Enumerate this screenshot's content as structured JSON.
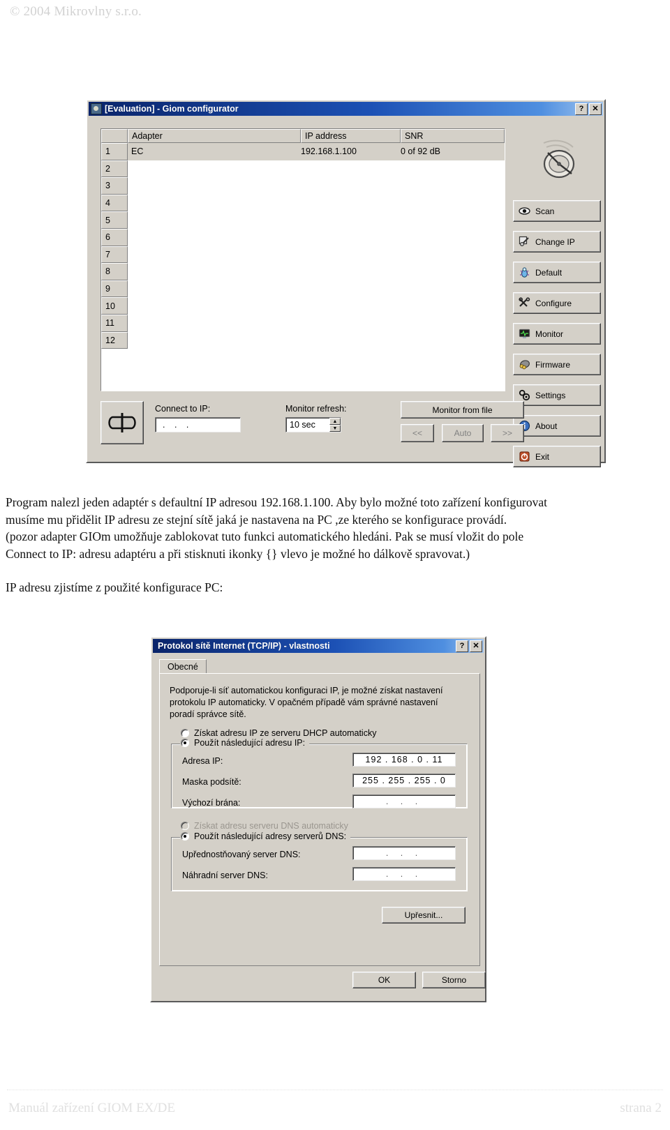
{
  "page": {
    "header": "© 2004 Mikrovlny s.r.o.",
    "footer_left": "Manuál zařízení GIOM EX/DE",
    "footer_right": "strana 2"
  },
  "paragraphs": {
    "p1_line1": "Program nalezl jeden adaptér s defaultní IP adresou  192.168.1.100. Aby bylo možné toto zařízení konfigurovat",
    "p1_line2": "musíme mu přidělit IP adresu ze stejní sítě jaká je nastavena na PC ,ze kterého se konfigurace provádí.",
    "p2_line1": "(pozor adapter GIOm umožňuje zablokovat tuto funkci automatického hledáni. Pak se musí vložit  do pole",
    "p2_line2": "Connect to IP: adresu adaptéru a při stisknuti ikonky {} vlevo je možné ho dálkově spravovat.)",
    "p3": "IP adresu zjistíme z použité konfigurace PC:"
  },
  "giom": {
    "title": "[Evaluation] - Giom configurator",
    "icon": "satellite-app-icon",
    "help_button": "?",
    "close_button": "✕",
    "columns": [
      "Adapter",
      "IP address",
      "SNR"
    ],
    "rows": [
      {
        "num": "1",
        "adapter": "EC",
        "ip": "192.168.1.100",
        "snr": "0 of 92 dB"
      },
      {
        "num": "2",
        "adapter": "",
        "ip": "",
        "snr": ""
      },
      {
        "num": "3",
        "adapter": "",
        "ip": "",
        "snr": ""
      },
      {
        "num": "4",
        "adapter": "",
        "ip": "",
        "snr": ""
      },
      {
        "num": "5",
        "adapter": "",
        "ip": "",
        "snr": ""
      },
      {
        "num": "6",
        "adapter": "",
        "ip": "",
        "snr": ""
      },
      {
        "num": "7",
        "adapter": "",
        "ip": "",
        "snr": ""
      },
      {
        "num": "8",
        "adapter": "",
        "ip": "",
        "snr": ""
      },
      {
        "num": "9",
        "adapter": "",
        "ip": "",
        "snr": ""
      },
      {
        "num": "10",
        "adapter": "",
        "ip": "",
        "snr": ""
      },
      {
        "num": "11",
        "adapter": "",
        "ip": "",
        "snr": ""
      },
      {
        "num": "12",
        "adapter": "",
        "ip": "",
        "snr": ""
      }
    ],
    "buttons": [
      {
        "label": "Scan",
        "icon": "eye-icon"
      },
      {
        "label": "Change IP",
        "icon": "wrench-icon"
      },
      {
        "label": "Default",
        "icon": "bug-icon"
      },
      {
        "label": "Configure",
        "icon": "tools-icon"
      },
      {
        "label": "Monitor",
        "icon": "monitor-icon"
      },
      {
        "label": "Firmware",
        "icon": "chip-icon"
      },
      {
        "label": "Settings",
        "icon": "gears-icon"
      },
      {
        "label": "About",
        "icon": "info-icon"
      },
      {
        "label": "Exit",
        "icon": "power-icon"
      }
    ],
    "bottom": {
      "plug_icon": "plug-connector-icon",
      "connect_label": "Connect to IP:",
      "connect_value": ".  .  .",
      "refresh_label": "Monitor refresh:",
      "refresh_value": "10 sec",
      "monitor_from_file": "Monitor from file",
      "prev": "<<",
      "auto": "Auto",
      "next": ">>"
    }
  },
  "tcpip": {
    "title": "Protokol sítě Internet (TCP/IP) - vlastnosti",
    "help_button": "?",
    "close_button": "✕",
    "tab": "Obecné",
    "description_line1": "Podporuje-li síť automatickou konfiguraci IP, je možné získat nastavení",
    "description_line2": "protokolu IP automaticky. V opačném případě vám správné nastavení",
    "description_line3": "poradí správce sítě.",
    "radio_dhcp_auto": "Získat adresu IP ze serveru DHCP automaticky",
    "radio_static_ip": "Použít následující adresu IP:",
    "label_ip": "Adresa IP:",
    "value_ip": "192 . 168 .  0  .  11",
    "label_mask": "Maska podsítě:",
    "value_mask": "255 . 255 . 255 .  0",
    "label_gateway": "Výchozí brána:",
    "value_gateway": ".    .    .",
    "radio_dns_auto": "Získat adresu serveru DNS automaticky",
    "radio_dns_static": "Použít následující adresy serverů DNS:",
    "label_dns_pref": "Upřednostňovaný server DNS:",
    "value_dns_pref": ".    .    .",
    "label_dns_alt": "Náhradní server DNS:",
    "value_dns_alt": ".    .    .",
    "button_advanced": "Upřesnit...",
    "button_ok": "OK",
    "button_cancel": "Storno"
  }
}
